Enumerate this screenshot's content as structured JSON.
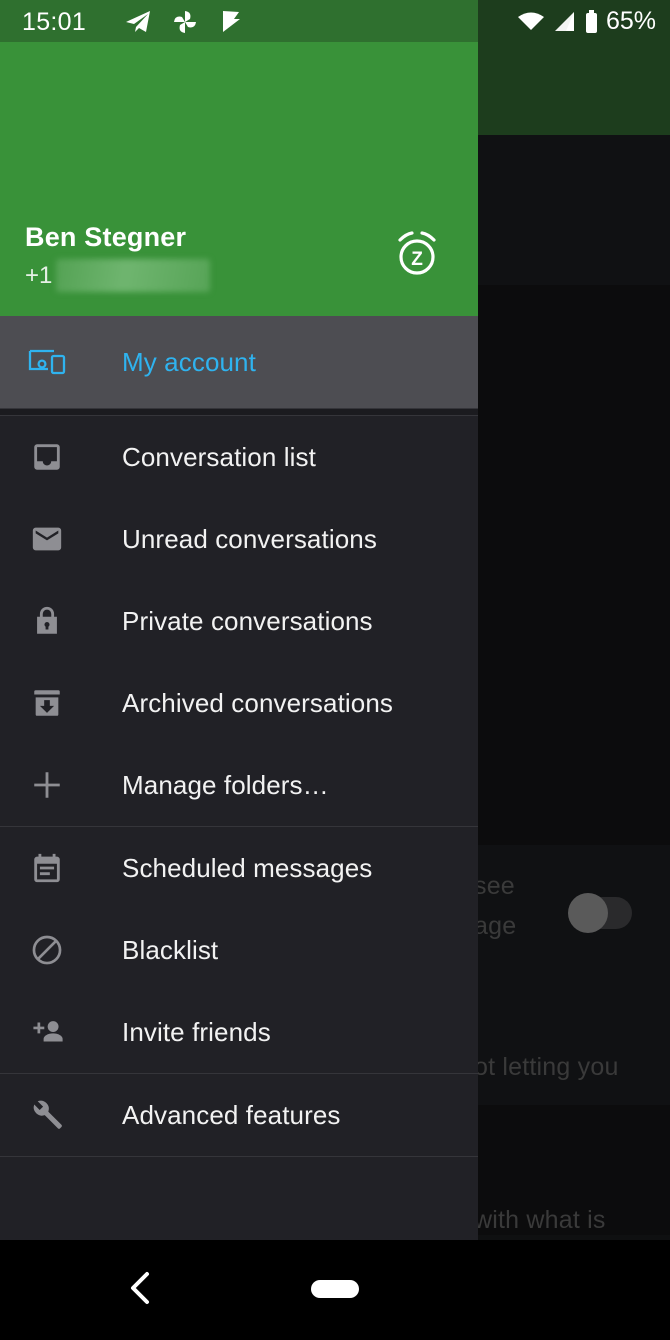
{
  "status_bar": {
    "time": "15:01",
    "battery_percent": "65%",
    "left_icons": [
      "telegram-icon",
      "pinwheel-icon",
      "flag-check-icon"
    ],
    "right_icons": [
      "wifi-icon",
      "cell-signal-icon",
      "battery-icon"
    ],
    "left_bg_color": "#2f702f",
    "right_bg_color": "#1d3d1d"
  },
  "drawer": {
    "header": {
      "account_name": "Ben Stegner",
      "country_code": "+1",
      "phone_redacted": true,
      "snooze_icon": "alarm-snooze-icon",
      "background_color": "#399239"
    },
    "selected_item": {
      "label": "My account",
      "icon": "devices-icon",
      "accent_color": "#2fb3ef",
      "row_background": "#4d4d52"
    },
    "groups": [
      {
        "items": [
          {
            "label": "Conversation list",
            "icon": "inbox-icon"
          },
          {
            "label": "Unread conversations",
            "icon": "envelope-icon"
          },
          {
            "label": "Private conversations",
            "icon": "lock-icon"
          },
          {
            "label": "Archived conversations",
            "icon": "archive-icon"
          },
          {
            "label": "Manage folders…",
            "icon": "plus-icon"
          }
        ]
      },
      {
        "items": [
          {
            "label": "Scheduled messages",
            "icon": "calendar-icon"
          },
          {
            "label": "Blacklist",
            "icon": "block-circle-icon"
          },
          {
            "label": "Invite friends",
            "icon": "person-add-icon"
          }
        ]
      },
      {
        "items": [
          {
            "label": "Advanced features",
            "icon": "wrench-icon"
          }
        ]
      }
    ],
    "background_color": "#212126"
  },
  "background_app": {
    "appbar_color": "#1d3d1d",
    "partial_texts": [
      "see",
      "age",
      "ot letting you",
      "with what is"
    ],
    "toggle": {
      "state": "off"
    }
  },
  "nav_bar": {
    "back_icon": "chevron-back-icon",
    "home_icon": "home-pill-icon"
  }
}
